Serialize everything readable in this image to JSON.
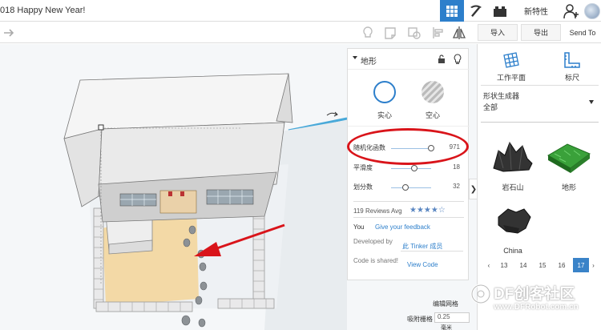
{
  "topbar": {
    "title": "018 Happy New Year!",
    "new_features": "新特性"
  },
  "toolbar": {
    "import_label": "导入",
    "export_label": "导出",
    "sendto_label": "Send To"
  },
  "inspector": {
    "title": "地形",
    "solid_label": "实心",
    "hole_label": "空心",
    "properties": [
      {
        "label": "随机化函数",
        "value": "971",
        "fraction": 0.97
      },
      {
        "label": "平滑度",
        "value": "18",
        "fraction": 0.58
      },
      {
        "label": "划分数",
        "value": "32",
        "fraction": 0.35
      }
    ],
    "reviews": "119 Reviews Avg",
    "stars": "★★★★☆",
    "you_label": "You",
    "feedback_link": "Give your feedback",
    "developed_by_label": "Developed by",
    "developer_link": "此 Tinker 成员",
    "code_shared_label": "Code is shared!",
    "view_code_link": "View Code"
  },
  "library": {
    "workplane_label": "工作平面",
    "ruler_label": "标尺",
    "generator_title": "形状生成器",
    "generator_value": "全部",
    "shapes": [
      {
        "label": "岩石山"
      },
      {
        "label": "地形"
      },
      {
        "label": "China"
      }
    ],
    "pages": [
      "13",
      "14",
      "15",
      "16",
      "17"
    ],
    "active_page": "17"
  },
  "snap": {
    "edit_grid": "编辑网格",
    "snap_grid": "吸附栅格",
    "value": "0.25",
    "unit": "毫米"
  },
  "watermark": {
    "title": "DF创客社区",
    "url": "www.DFRobot.com.cn"
  },
  "colors": {
    "accent": "#2d7fcb",
    "annotation": "#d9141a",
    "terrain": "#3aa13a"
  }
}
